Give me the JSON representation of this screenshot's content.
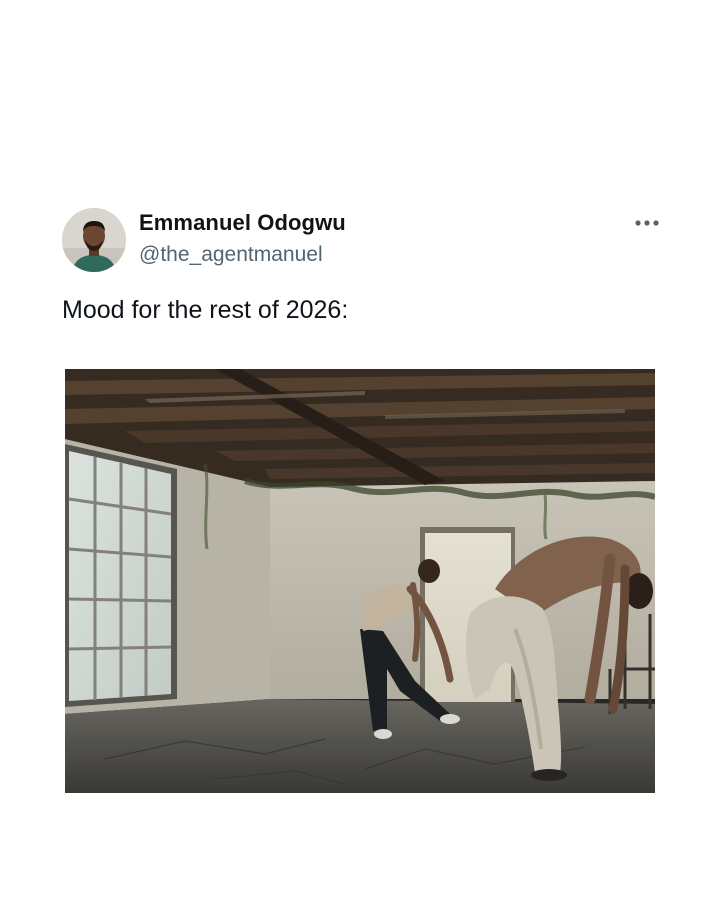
{
  "post": {
    "author": {
      "display_name": "Emmanuel Odogwu",
      "handle": "@the_agentmanuel",
      "avatar_icon": "person-avatar-icon"
    },
    "more_icon": "more-horizontal-icon",
    "text": "Mood for the rest of 2026:",
    "media": {
      "type": "video-still",
      "scene": "two dancers in an empty room with exposed wooden ceiling beams and a large window"
    }
  },
  "colors": {
    "primary_text": "#0f1419",
    "secondary_text": "#536471",
    "background": "#ffffff"
  }
}
